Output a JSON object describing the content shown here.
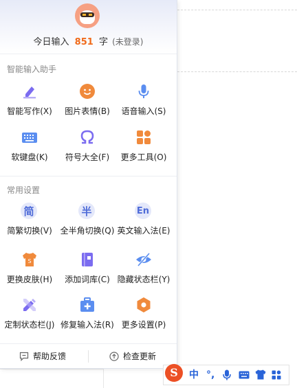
{
  "header": {
    "count_prefix": "今日输入",
    "count_value": "851",
    "count_unit": "字",
    "login_status": "(未登录)",
    "avatar_icon": "robot-avatar-icon"
  },
  "sections": {
    "smart_title": "智能输入助手",
    "common_title": "常用设置"
  },
  "smart_items": [
    {
      "label": "智能写作(X)",
      "icon": "pen-write-icon"
    },
    {
      "label": "图片表情(B)",
      "icon": "emoji-icon"
    },
    {
      "label": "语音输入(S)",
      "icon": "microphone-icon"
    },
    {
      "label": "软键盘(K)",
      "icon": "keyboard-icon"
    },
    {
      "label": "符号大全(F)",
      "icon": "omega-symbol-icon"
    },
    {
      "label": "更多工具(O)",
      "icon": "tools-grid-icon"
    }
  ],
  "common_items": [
    {
      "label": "简繁切换(V)",
      "icon": "simplified-traditional-icon",
      "glyph": "简"
    },
    {
      "label": "全半角切换(Q)",
      "icon": "half-width-icon",
      "glyph": "半"
    },
    {
      "label": "英文输入法(E)",
      "icon": "english-input-icon",
      "glyph": "En"
    },
    {
      "label": "更换皮肤(H)",
      "icon": "skin-shirt-icon"
    },
    {
      "label": "添加词库(C)",
      "icon": "dictionary-icon"
    },
    {
      "label": "隐藏状态栏(Y)",
      "icon": "hide-eye-icon"
    },
    {
      "label": "定制状态栏(J)",
      "icon": "customize-pencil-icon"
    },
    {
      "label": "修复输入法(R)",
      "icon": "repair-kit-icon"
    },
    {
      "label": "更多设置(P)",
      "icon": "settings-hexagon-icon"
    }
  ],
  "footer": {
    "feedback_label": "帮助反馈",
    "update_label": "检查更新"
  },
  "status_bar": {
    "logo": "S",
    "mode": "中",
    "punct": "°,"
  },
  "colors": {
    "accent_orange": "#f06a1a",
    "icon_blue": "#4e6bd8",
    "icon_purple": "#7b6cf0",
    "icon_orange": "#f08a3c",
    "sogou_red": "#ec5025"
  }
}
